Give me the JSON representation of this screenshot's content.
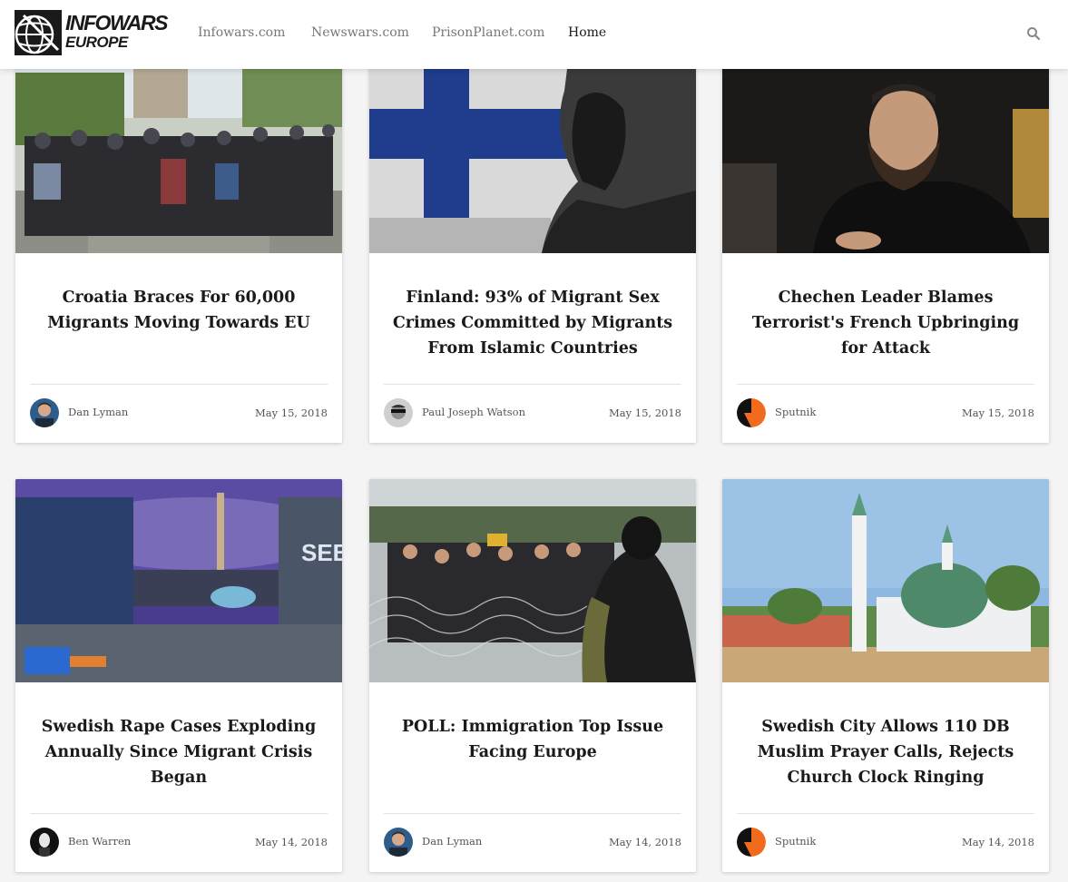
{
  "header": {
    "logo_line1": "INFOWARS",
    "logo_line2": "EUROPE",
    "nav": [
      {
        "label": "Infowars.com"
      },
      {
        "label": "Newswars.com"
      },
      {
        "label": "PrisonPlanet.com"
      },
      {
        "label": "Home"
      }
    ],
    "active_nav": "Home",
    "search_icon": "search-icon"
  },
  "articles": [
    {
      "title": "Croatia Braces For 60,000 Migrants Moving Towards EU",
      "author": "Dan Lyman",
      "date": "May 15, 2018"
    },
    {
      "title": "Finland: 93% of Migrant Sex Crimes Committed by Migrants From Islamic Countries",
      "author": "Paul Joseph Watson",
      "date": "May 15, 2018"
    },
    {
      "title": "Chechen Leader Blames Terrorist's French Upbringing for Attack",
      "author": "Sputnik",
      "date": "May 15, 2018"
    },
    {
      "title": "Swedish Rape Cases Exploding Annually Since Migrant Crisis Began",
      "author": "Ben Warren",
      "date": "May 14, 2018"
    },
    {
      "title": "POLL: Immigration Top Issue Facing Europe",
      "author": "Dan Lyman",
      "date": "May 14, 2018"
    },
    {
      "title": "Swedish City Allows 110 DB Muslim Prayer Calls, Rejects Church Clock Ringing",
      "author": "Sputnik",
      "date": "May 14, 2018"
    }
  ],
  "colors": {
    "header_bg": "#ffffff",
    "page_bg": "#f4f4f4",
    "title_text": "#1a1a1a",
    "nav_text": "#777777",
    "sputnik_orange": "#f26a1b"
  }
}
